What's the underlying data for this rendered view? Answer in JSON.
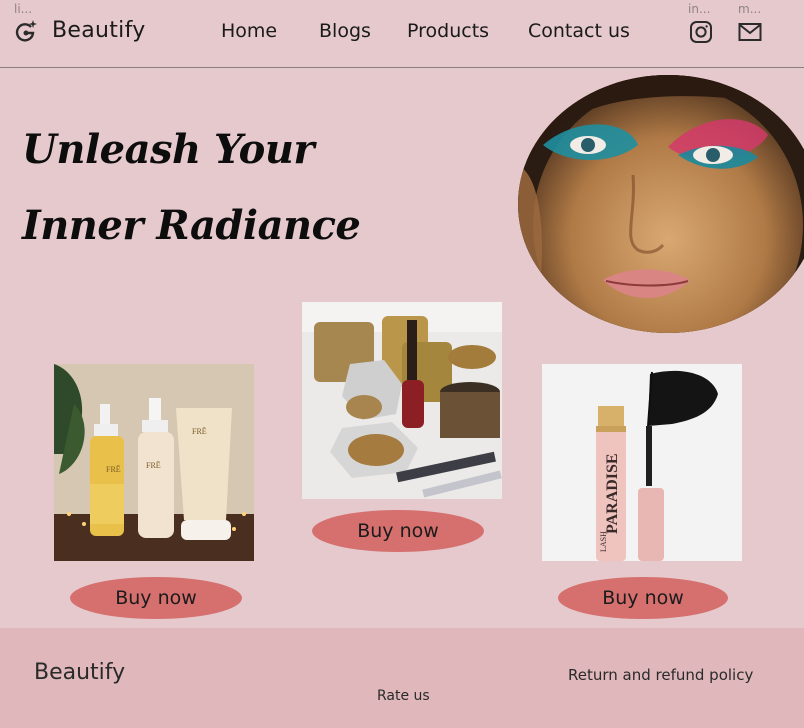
{
  "header": {
    "tiny_link_left": "li...",
    "tiny_link_instagram": "in...",
    "tiny_link_mail": "m...",
    "brand": "Beautify",
    "nav": [
      "Home",
      "Blogs",
      "Products",
      "Contact us"
    ],
    "icons": [
      "logo-icon",
      "instagram-icon",
      "mail-icon"
    ]
  },
  "hero": {
    "title_line1": "Unleash Your",
    "title_line2": "Inner Radiance"
  },
  "products": [
    {
      "button_label": "Buy now",
      "image": "skincare-bottles-photo"
    },
    {
      "button_label": "Buy now",
      "image": "highlighter-compact-photo"
    },
    {
      "button_label": "Buy now",
      "image": "mascara-photo"
    }
  ],
  "product_labels": {
    "bottle_brand": "FRĒ",
    "mascara_brand": "PARADISE",
    "mascara_sub": "LASH"
  },
  "footer": {
    "brand": "Beautify",
    "rate": "Rate us",
    "policy": "Return and refund policy"
  },
  "colors": {
    "background": "#e5c9cc",
    "footer": "#e0b8bb",
    "button": "#d5706f"
  }
}
